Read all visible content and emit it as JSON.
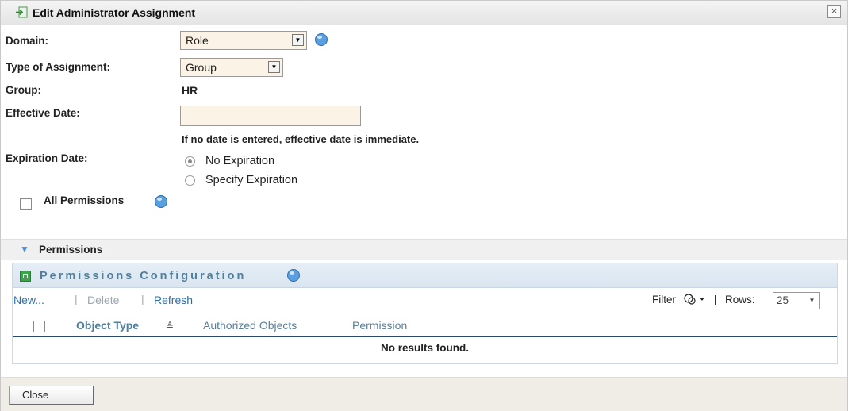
{
  "dialog": {
    "title": "Edit Administrator Assignment",
    "close_glyph": "×"
  },
  "form": {
    "domain_label": "Domain:",
    "domain_value": "Role",
    "type_label": "Type of Assignment:",
    "type_value": "Group",
    "group_label": "Group:",
    "group_value": "HR",
    "effective_label": "Effective Date:",
    "effective_value": "",
    "effective_hint": "If no date is entered, effective date is immediate.",
    "expiration_label": "Expiration Date:",
    "expiration_options": [
      "No Expiration",
      "Specify Expiration"
    ],
    "expiration_selected": "No Expiration",
    "all_permissions_label": "All Permissions",
    "all_permissions_checked": false
  },
  "permissions_section": {
    "title": "Permissions",
    "expanded": true
  },
  "config_panel": {
    "title": "Permissions Configuration",
    "toolbar": {
      "new": "New...",
      "delete": "Delete",
      "refresh": "Refresh",
      "sep": "|",
      "filter": "Filter",
      "rows_label": "Rows:",
      "rows_value": "25"
    },
    "columns": [
      "Object Type",
      "Authorized Objects",
      "Permission"
    ],
    "sort_indicator": "≜",
    "empty_message": "No results found."
  },
  "footer": {
    "close_label": "Close"
  },
  "icons": [
    "edit-assignment-icon",
    "info-icon",
    "dropdown-arrow-icon",
    "chevron-down-icon",
    "config-icon",
    "filter-icon",
    "close-icon"
  ],
  "colors": {
    "field_bg": "#fbf3e6",
    "link_blue": "#2f6fa6",
    "disabled": "#9aa6b0",
    "panel_title": "#4f7f9c",
    "footer_bg": "#f0ede7"
  }
}
